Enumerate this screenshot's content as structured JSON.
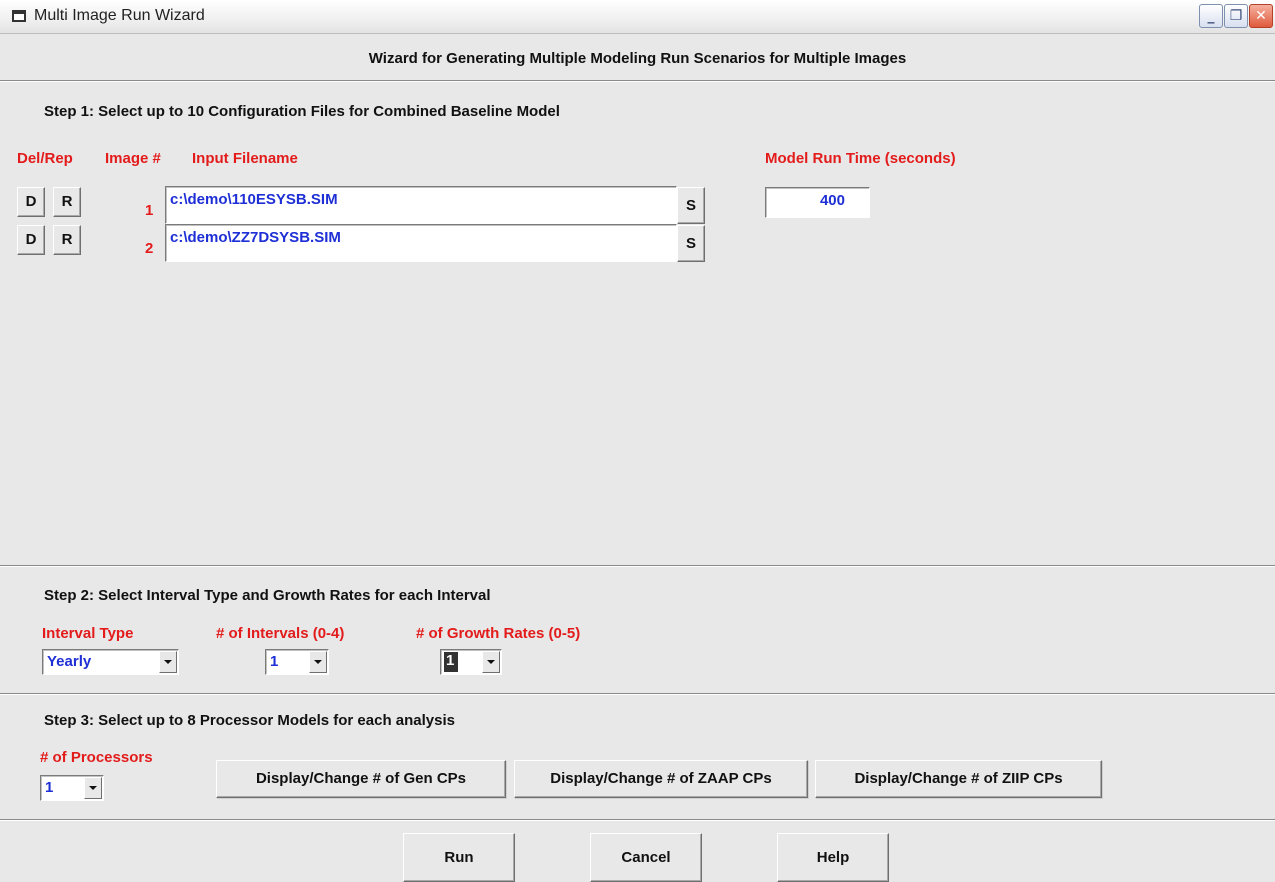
{
  "window": {
    "title": "Multi Image Run Wizard",
    "controls": {
      "minimize": "_",
      "restore": "❐",
      "close": "✕"
    }
  },
  "header": {
    "title": "Wizard for Generating Multiple Modeling Run Scenarios for Multiple Images"
  },
  "step1": {
    "title": "Step 1: Select up to 10 Configuration Files for Combined Baseline Model",
    "columns": {
      "delrep": "Del/Rep",
      "image_num": "Image #",
      "input_filename": "Input Filename",
      "run_time": "Model Run Time (seconds)"
    },
    "rows": [
      {
        "del": "D",
        "rep": "R",
        "num": "1",
        "filename": "c:\\demo\\110ESYSB.SIM",
        "select": "S"
      },
      {
        "del": "D",
        "rep": "R",
        "num": "2",
        "filename": "c:\\demo\\ZZ7DSYSB.SIM",
        "select": "S"
      }
    ],
    "run_time_value": "400"
  },
  "step2": {
    "title": "Step 2: Select Interval Type and Growth Rates for each Interval",
    "interval_type": {
      "label": "Interval Type",
      "value": "Yearly"
    },
    "num_intervals": {
      "label": "# of Intervals (0-4)",
      "value": "1"
    },
    "num_growth_rates": {
      "label": "# of Growth Rates (0-5)",
      "value": "1"
    }
  },
  "step3": {
    "title": "Step 3: Select up to 8 Processor Models for each analysis",
    "num_processors": {
      "label": "# of Processors",
      "value": "1"
    },
    "buttons": {
      "gen_cps": "Display/Change # of Gen CPs",
      "zaap_cps": "Display/Change # of ZAAP CPs",
      "ziip_cps": "Display/Change # of ZIIP CPs"
    }
  },
  "actions": {
    "run": "Run",
    "cancel": "Cancel",
    "help": "Help"
  },
  "colors": {
    "label_red": "#e31b1b",
    "value_blue": "#1e2fd6",
    "background": "#e8e8e8"
  }
}
